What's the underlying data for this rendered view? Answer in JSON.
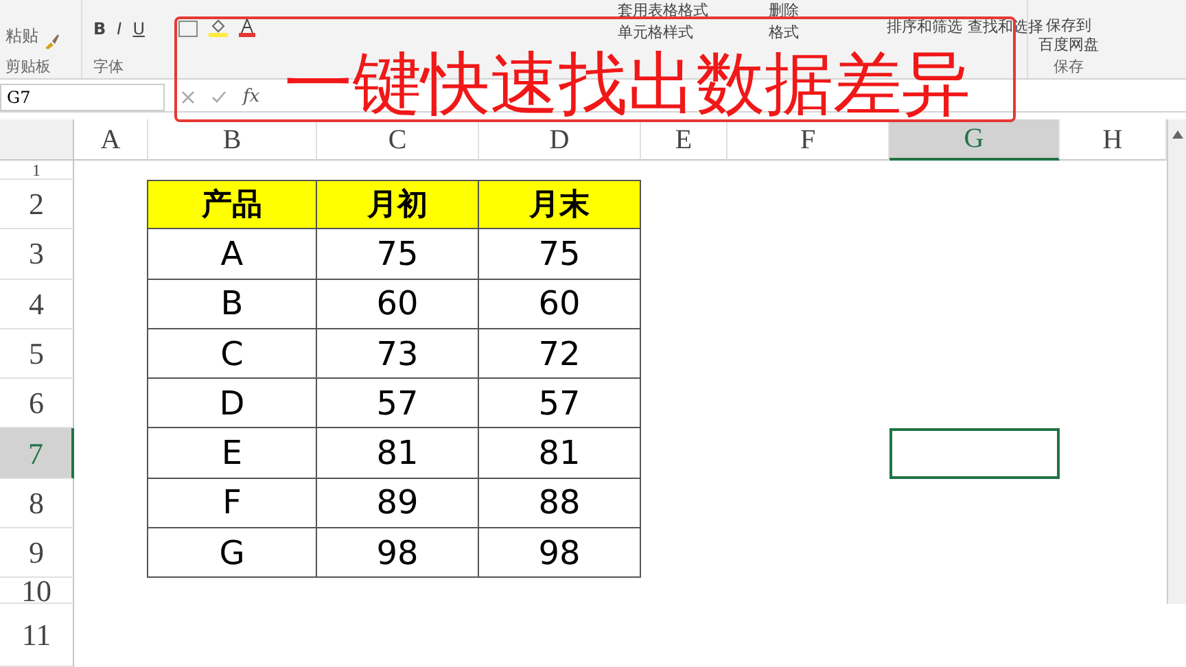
{
  "ribbon": {
    "clipboard": {
      "paste": "粘贴",
      "label": "剪贴板"
    },
    "font": {
      "bold": "B",
      "italic": "I",
      "underline": "U",
      "label": "字体"
    },
    "styles": [
      {
        "label": "套用表格格式"
      },
      {
        "label": "单元格样式"
      }
    ],
    "cells": [
      {
        "label": "删除"
      },
      {
        "label": "格式"
      }
    ],
    "editing": [
      {
        "label": "排序和筛选"
      },
      {
        "label": "查找和选择"
      }
    ],
    "save": {
      "line_1": "保存到",
      "line_2": "百度网盘",
      "label": "保存"
    }
  },
  "formula_bar": {
    "name_box": "G7",
    "fx": "fx"
  },
  "caption": "一键快速找出数据差异",
  "columns": [
    {
      "label": "A",
      "selected": false
    },
    {
      "label": "B",
      "selected": false
    },
    {
      "label": "C",
      "selected": false
    },
    {
      "label": "D",
      "selected": false
    },
    {
      "label": "E",
      "selected": false
    },
    {
      "label": "F",
      "selected": false
    },
    {
      "label": "G",
      "selected": true
    },
    {
      "label": "H",
      "selected": false
    }
  ],
  "rows": [
    {
      "label": "1",
      "selected": false
    },
    {
      "label": "2",
      "selected": false
    },
    {
      "label": "3",
      "selected": false
    },
    {
      "label": "4",
      "selected": false
    },
    {
      "label": "5",
      "selected": false
    },
    {
      "label": "6",
      "selected": false
    },
    {
      "label": "7",
      "selected": true
    },
    {
      "label": "8",
      "selected": false
    },
    {
      "label": "9",
      "selected": false
    },
    {
      "label": "10",
      "selected": false
    },
    {
      "label": "11",
      "selected": false
    }
  ],
  "table": {
    "header": [
      "产品",
      "月初",
      "月末"
    ],
    "rows": [
      [
        "A",
        "75",
        "75"
      ],
      [
        "B",
        "60",
        "60"
      ],
      [
        "C",
        "73",
        "72"
      ],
      [
        "D",
        "57",
        "57"
      ],
      [
        "E",
        "81",
        "81"
      ],
      [
        "F",
        "89",
        "88"
      ],
      [
        "G",
        "98",
        "98"
      ]
    ]
  }
}
